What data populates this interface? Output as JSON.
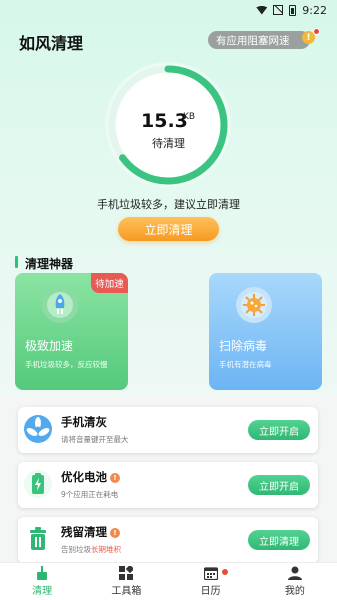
{
  "status_bar": {
    "time": "9:22"
  },
  "header": {
    "title": "如风清理",
    "block_pill_label": "有应用阻塞网速",
    "block_badge": "!"
  },
  "gauge": {
    "value": "15.3",
    "unit": "KB",
    "label": "待清理",
    "progress": 0.65
  },
  "advice": {
    "text": "手机垃圾较多，建议立即清理",
    "button_label": "立即清理"
  },
  "tools_section": {
    "title": "清理神器",
    "cards": [
      {
        "title": "极致加速",
        "subtitle": "手机垃圾较多，反应较慢",
        "badge": "待加速",
        "icon": "rocket-icon"
      },
      {
        "title": "扫除病毒",
        "subtitle": "手机有潜在病毒",
        "icon": "virus-icon"
      }
    ]
  },
  "list": [
    {
      "title": "手机清灰",
      "subtitle": "请将音量键开至最大",
      "button": "立即开启",
      "icon": "fan-icon"
    },
    {
      "title": "优化电池",
      "subtitle": "9个应用正在耗电",
      "button": "立即开启",
      "icon": "battery-icon",
      "dot": "!"
    },
    {
      "title": "残留清理",
      "subtitle_prefix": "告别垃圾",
      "subtitle_highlight": "长期堆积",
      "button": "立即清理",
      "icon": "trash-icon",
      "dot": "!"
    }
  ],
  "tabbar": {
    "tabs": [
      {
        "label": "清理",
        "active": true,
        "icon": "broom-icon"
      },
      {
        "label": "工具箱",
        "icon": "toolbox-icon"
      },
      {
        "label": "日历",
        "icon": "calendar-icon",
        "dot": true
      },
      {
        "label": "我的",
        "icon": "profile-icon"
      }
    ]
  },
  "colors": {
    "brand_green": "#2bb673",
    "orange": "#f69a22",
    "warning_red": "#e94a3a"
  }
}
